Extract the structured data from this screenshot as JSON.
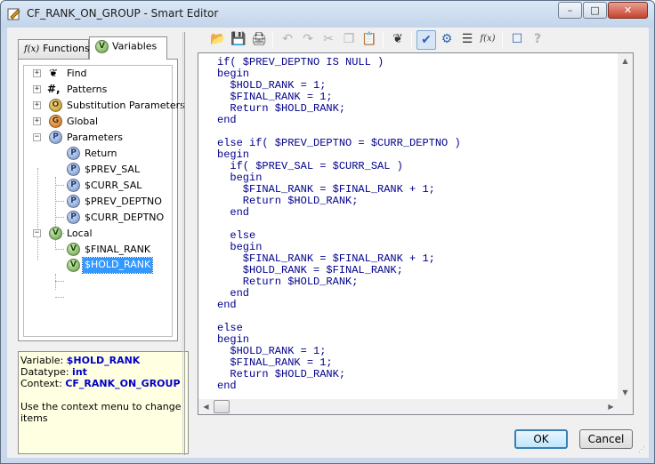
{
  "window": {
    "title": "CF_RANK_ON_GROUP - Smart Editor",
    "controls": {
      "minimize": "–",
      "maximize": "□",
      "close": "✕"
    }
  },
  "tabs": [
    {
      "label": "Functions",
      "icon": "function-icon",
      "icon_text": "f(x)"
    },
    {
      "label": "Variables",
      "icon": "variable-icon",
      "icon_text": "V"
    }
  ],
  "tree": {
    "items": [
      {
        "label": "Find",
        "icon": "binoculars-icon",
        "glyph": "❦"
      },
      {
        "label": "Patterns",
        "icon": "hash-icon",
        "glyph": "#,"
      },
      {
        "label": "Substitution Parameters",
        "icon": "substitution-parameter-icon",
        "glyph": "O"
      },
      {
        "label": "Global",
        "icon": "global-icon",
        "glyph": "G"
      },
      {
        "label": "Parameters",
        "icon": "parameter-icon",
        "glyph": "P",
        "children": [
          "Return",
          "$PREV_SAL",
          "$CURR_SAL",
          "$PREV_DEPTNO",
          "$CURR_DEPTNO"
        ]
      },
      {
        "label": "Local",
        "icon": "variable-icon",
        "glyph": "V",
        "children": [
          "$FINAL_RANK",
          "$HOLD_RANK"
        ]
      }
    ],
    "selected": "$HOLD_RANK"
  },
  "info": {
    "variable_label": "Variable:",
    "variable_value": "$HOLD_RANK",
    "datatype_label": "Datatype:",
    "datatype_value": "int",
    "context_label": "Context:",
    "context_value": "CF_RANK_ON_GROUP",
    "hint": "Use the context menu to change items"
  },
  "toolbar": {
    "buttons": [
      {
        "name": "open-icon",
        "glyph": "📂",
        "enabled": true
      },
      {
        "name": "save-icon",
        "glyph": "💾",
        "enabled": true
      },
      {
        "name": "print-icon",
        "glyph": "🖨",
        "enabled": true
      },
      {
        "name": "undo-icon",
        "glyph": "↶",
        "enabled": false
      },
      {
        "name": "redo-icon",
        "glyph": "↷",
        "enabled": false
      },
      {
        "name": "cut-icon",
        "glyph": "✂",
        "enabled": false
      },
      {
        "name": "copy-icon",
        "glyph": "❐",
        "enabled": false
      },
      {
        "name": "paste-icon",
        "glyph": "📋",
        "enabled": true
      },
      {
        "name": "find-icon",
        "glyph": "❦",
        "enabled": true
      },
      {
        "name": "validate-icon",
        "glyph": "✔",
        "enabled": true
      },
      {
        "name": "show-variables-icon",
        "glyph": "⚙",
        "enabled": true
      },
      {
        "name": "list-icon",
        "glyph": "☰",
        "enabled": true
      },
      {
        "name": "function-icon",
        "glyph": "f(x)",
        "enabled": true
      },
      {
        "name": "comment-icon",
        "glyph": "☐",
        "enabled": true
      },
      {
        "name": "help-icon",
        "glyph": "?",
        "enabled": false
      }
    ]
  },
  "code": [
    "if( $PREV_DEPTNO IS NULL )",
    "begin",
    "  $HOLD_RANK = 1;",
    "  $FINAL_RANK = 1;",
    "  Return $HOLD_RANK;",
    "end",
    "",
    "else if( $PREV_DEPTNO = $CURR_DEPTNO )",
    "begin",
    "  if( $PREV_SAL = $CURR_SAL )",
    "  begin",
    "    $FINAL_RANK = $FINAL_RANK + 1;",
    "    Return $HOLD_RANK;",
    "  end",
    "",
    "  else",
    "  begin",
    "    $FINAL_RANK = $FINAL_RANK + 1;",
    "    $HOLD_RANK = $FINAL_RANK;",
    "    Return $HOLD_RANK;",
    "  end",
    "end",
    "",
    "else",
    "begin",
    "  $HOLD_RANK = 1;",
    "  $FINAL_RANK = 1;",
    "  Return $HOLD_RANK;",
    "end"
  ],
  "buttons": {
    "ok": "OK",
    "cancel": "Cancel"
  }
}
